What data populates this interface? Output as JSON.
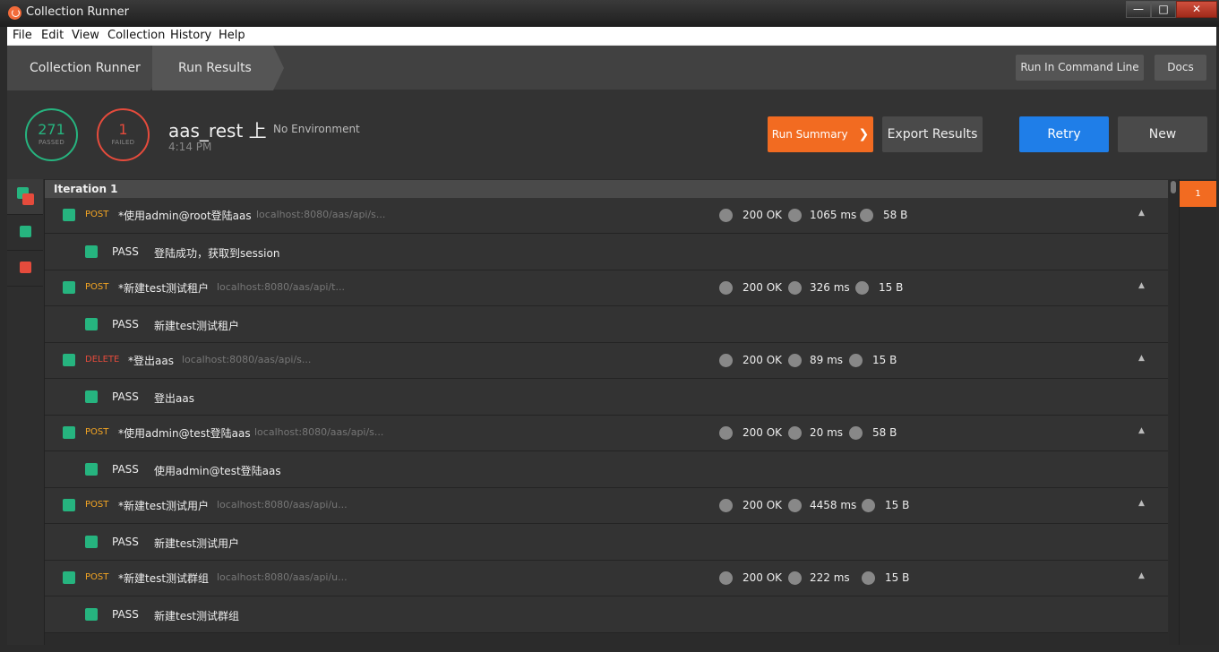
{
  "window": {
    "title": "Collection Runner"
  },
  "menu": [
    "File",
    "Edit",
    "View",
    "Collection",
    "History",
    "Help"
  ],
  "header": {
    "crumbs": [
      "Collection Runner",
      "Run Results"
    ],
    "run_cli_label": "Run In Command Line",
    "docs_label": "Docs"
  },
  "summary": {
    "passed_count": "271",
    "passed_label": "PASSED",
    "failed_count": "1",
    "failed_label": "FAILED",
    "run_name": "aas_rest 上",
    "environment": "No Environment",
    "time": "4:14 PM",
    "run_summary_label": "Run Summary",
    "export_label": "Export Results",
    "retry_label": "Retry",
    "new_label": "New"
  },
  "iteration": {
    "label": "Iteration 1",
    "tab": "1"
  },
  "colors": {
    "pass": "#26b47f",
    "fail": "#e54b3c",
    "accent": "#f26b21",
    "primary": "#1f7ee8",
    "post": "#f5a623",
    "delete": "#e54b3c"
  },
  "results": [
    {
      "method": "POST",
      "name": "*使用admin@root登陆aas",
      "url": "localhost:8080/aas/api/s...",
      "status": "200 OK",
      "time": "1065 ms",
      "size": "58 B",
      "test_label": "PASS",
      "test": "登陆成功，获取到session"
    },
    {
      "method": "POST",
      "name": "*新建test测试租户",
      "url": "localhost:8080/aas/api/t...",
      "status": "200 OK",
      "time": "326 ms",
      "size": "15 B",
      "test_label": "PASS",
      "test": "新建test测试租户"
    },
    {
      "method": "DELETE",
      "name": "*登出aas",
      "url": "localhost:8080/aas/api/s...",
      "status": "200 OK",
      "time": "89 ms",
      "size": "15 B",
      "test_label": "PASS",
      "test": "登出aas"
    },
    {
      "method": "POST",
      "name": "*使用admin@test登陆aas",
      "url": "localhost:8080/aas/api/s...",
      "status": "200 OK",
      "time": "20 ms",
      "size": "58 B",
      "test_label": "PASS",
      "test": "使用admin@test登陆aas"
    },
    {
      "method": "POST",
      "name": "*新建test测试用户",
      "url": "localhost:8080/aas/api/u...",
      "status": "200 OK",
      "time": "4458 ms",
      "size": "15 B",
      "test_label": "PASS",
      "test": "新建test测试用户"
    },
    {
      "method": "POST",
      "name": "*新建test测试群组",
      "url": "localhost:8080/aas/api/u...",
      "status": "200 OK",
      "time": "222 ms",
      "size": "15 B",
      "test_label": "PASS",
      "test": "新建test测试群组"
    }
  ]
}
